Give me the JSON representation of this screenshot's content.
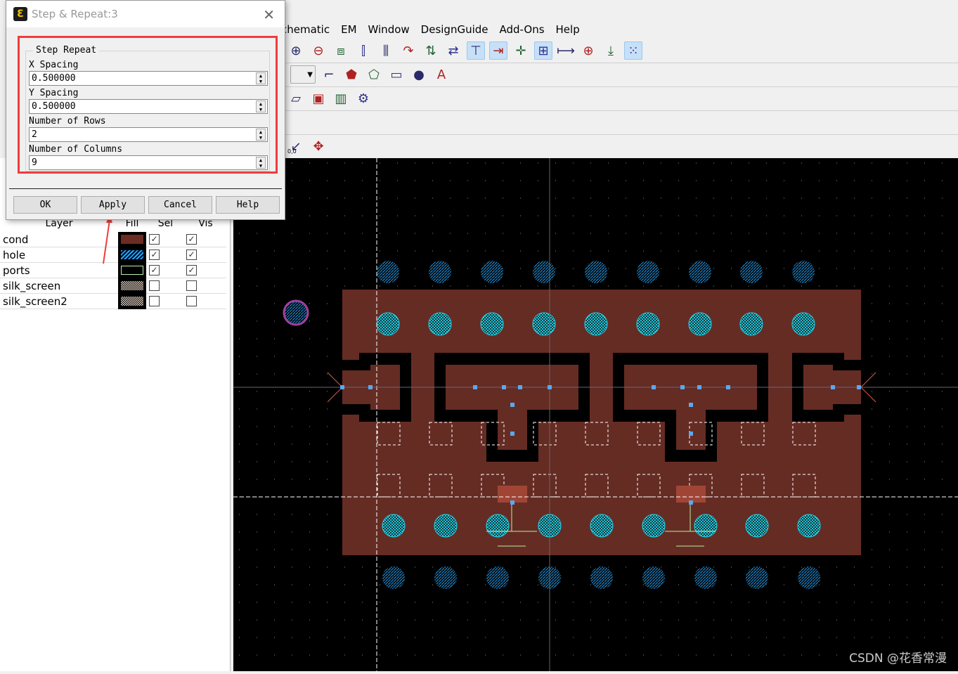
{
  "menu": [
    "chematic",
    "EM",
    "Window",
    "DesignGuide",
    "Add-Ons",
    "Help"
  ],
  "toolbar1": [
    {
      "icon": "zoom-in-2-icon",
      "g": "⊕"
    },
    {
      "icon": "zoom-out-2-icon",
      "g": "⊖"
    },
    {
      "icon": "component-icon",
      "g": "⧈"
    },
    {
      "icon": "align-left-icon",
      "g": "⫿"
    },
    {
      "icon": "align-multi-icon",
      "g": "⫼"
    },
    {
      "icon": "rotate-icon",
      "g": "↷"
    },
    {
      "icon": "mirror-icon",
      "g": "⇅"
    },
    {
      "icon": "flip-icon",
      "g": "⇄"
    },
    {
      "icon": "snap-grid-origin-icon",
      "g": "⊤",
      "on": true
    },
    {
      "icon": "snap-pin-icon",
      "g": "⇥",
      "on": true
    },
    {
      "icon": "snap-vertex-icon",
      "g": "✛"
    },
    {
      "icon": "snap-intersection-icon",
      "g": "⊞",
      "on": true
    },
    {
      "icon": "snap-edge-icon",
      "g": "⟼"
    },
    {
      "icon": "snap-center-icon",
      "g": "⊕"
    },
    {
      "icon": "snap-midpoint-icon",
      "g": "⤓"
    },
    {
      "icon": "snap-grid-icon",
      "g": "⁙",
      "on": true
    }
  ],
  "toolbar2": [
    {
      "icon": "path-icon",
      "g": "⌐"
    },
    {
      "icon": "polygon-icon",
      "g": "⬟"
    },
    {
      "icon": "polyline-icon",
      "g": "⬠"
    },
    {
      "icon": "rectangle-icon",
      "g": "▭"
    },
    {
      "icon": "circle-icon",
      "g": "●"
    },
    {
      "icon": "text-icon",
      "g": "A"
    }
  ],
  "toolbar3": [
    {
      "icon": "3d-view-icon",
      "g": "▱"
    },
    {
      "icon": "3d-box-icon",
      "g": "▣"
    },
    {
      "icon": "color-cube-icon",
      "g": "▥"
    },
    {
      "icon": "simulation-settings-icon",
      "g": "⚙"
    }
  ],
  "toolbar4": [
    {
      "icon": "origin-icon",
      "g": "↙"
    },
    {
      "icon": "move-reference-icon",
      "g": "✥"
    }
  ],
  "origin_label": "0,0",
  "dialog": {
    "title": "Step & Repeat:3",
    "group": "Step Repeat",
    "fields": [
      {
        "label": "X Spacing",
        "value": "0.500000"
      },
      {
        "label": "Y Spacing",
        "value": "0.500000"
      },
      {
        "label": "Number of Rows",
        "value": "2"
      },
      {
        "label": "Number of Columns",
        "value": "9"
      }
    ],
    "buttons": [
      "OK",
      "Apply",
      "Cancel",
      "Help"
    ]
  },
  "layers": {
    "headers": [
      "Layer",
      "Fill",
      "Sel",
      "Vis"
    ],
    "rows": [
      {
        "name": "cond",
        "color": "#6b2c24",
        "sel": true,
        "vis": true
      },
      {
        "name": "hole",
        "color": "#1ab0e8",
        "sel": true,
        "vis": true
      },
      {
        "name": "ports",
        "color": "#000000",
        "sel": true,
        "vis": true
      },
      {
        "name": "silk_screen",
        "color": "#e0d0c0",
        "sel": false,
        "vis": false
      },
      {
        "name": "silk_screen2",
        "color": "#f0e0d0",
        "sel": false,
        "vis": false
      }
    ]
  },
  "colors": {
    "conductor": "#652c24",
    "hole_inner": "#2ad4e8",
    "hole_outer": "#1c7ab8",
    "port": "#a04535",
    "canvas": "#000000"
  },
  "watermark": "CSDN @花香常漫"
}
